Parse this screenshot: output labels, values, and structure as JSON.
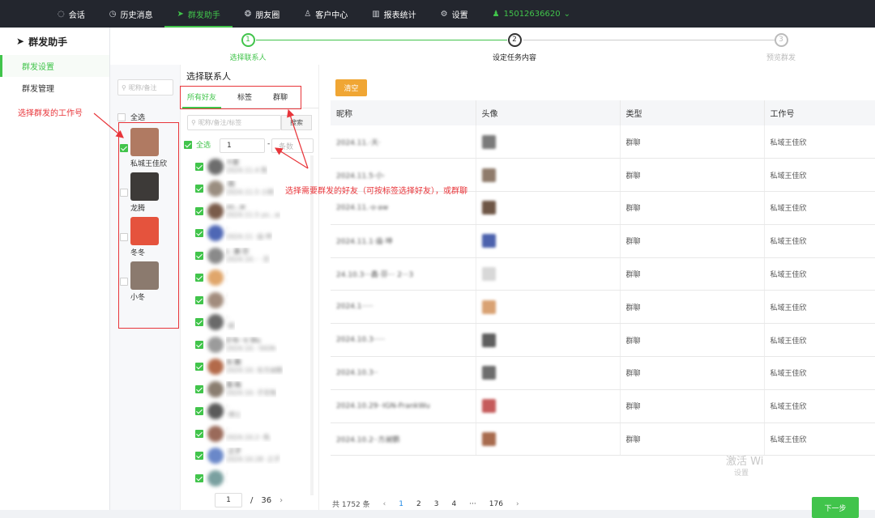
{
  "topnav": {
    "items": [
      {
        "label": "会话",
        "icon": "chat-icon"
      },
      {
        "label": "历史消息",
        "icon": "clock-icon"
      },
      {
        "label": "群发助手",
        "icon": "send-icon",
        "active": true
      },
      {
        "label": "朋友圈",
        "icon": "aperture-icon"
      },
      {
        "label": "客户中心",
        "icon": "user-icon"
      },
      {
        "label": "报表统计",
        "icon": "bar-chart-icon"
      },
      {
        "label": "设置",
        "icon": "gear-icon"
      }
    ],
    "user_phone": "15012636620",
    "accent_color": "#41c44b"
  },
  "sidebar": {
    "title": "群发助手",
    "items": [
      {
        "label": "群发设置",
        "active": true
      },
      {
        "label": "群发管理"
      }
    ]
  },
  "steps": [
    {
      "num": "1",
      "label": "选择联系人",
      "state": "done"
    },
    {
      "num": "2",
      "label": "设定任务内容",
      "state": "current"
    },
    {
      "num": "3",
      "label": "预览群发",
      "state": "todo"
    }
  ],
  "accounts_panel": {
    "search_placeholder": "昵称/备注",
    "select_all": "全选",
    "accounts": [
      {
        "name": "私城王佳欣",
        "checked": true,
        "avatar_color": "#b07a62"
      },
      {
        "name": "龙腾",
        "checked": false,
        "avatar_color": "#3d3a38"
      },
      {
        "name": "冬冬",
        "checked": false,
        "avatar_color": "#e5533d"
      },
      {
        "name": "小冬",
        "checked": false,
        "avatar_color": "#8b7a6e"
      }
    ]
  },
  "contacts_panel": {
    "title": "选择联系人",
    "tabs": [
      "所有好友",
      "标签",
      "群聊"
    ],
    "search_placeholder": "昵称/备注/标签",
    "search_button": "搜索",
    "select_all": "全选",
    "range_from": "1",
    "range_to_placeholder": "条数",
    "range_sep": "-",
    "rows": [
      {
        "line1": "十度",
        "line2": "2024.11.4 数",
        "color": "#6d6d6d"
      },
      {
        "line1": "·刚",
        "line2": "2024.11.5 小刚",
        "color": "#9a8d80"
      },
      {
        "line1": "vo...w",
        "line2": "2024.11.5 yo...w",
        "color": "#7a5b4a"
      },
      {
        "line1": "·",
        "line2": "2024.11 ·庙·坤",
        "color": "#4e67b5"
      },
      {
        "line1": "L· 鑫·芬",
        "line2": "2024.10.·· ·芬",
        "color": "#8a8a8a"
      },
      {
        "line1": "·",
        "line2": "·",
        "color": "#e0a66b"
      },
      {
        "line1": "·",
        "line2": "·",
        "color": "#a28c7d"
      },
      {
        "line1": "·",
        "line2": "·越",
        "color": "#6a6a6a"
      },
      {
        "line1": "D·N-··k Wu",
        "line2": "2024.10.··SIGN-",
        "color": "#9b9b9b"
      },
      {
        "line1": "东·鹏",
        "line2": "2024.10.·东方昶鹏",
        "color": "#b36a4a"
      },
      {
        "line1": "落·梅",
        "line2": "2024.10.·子无悔",
        "color": "#8a7d70"
      },
      {
        "line1": "·",
        "line2": "·博士",
        "color": "#5a5a5a"
      },
      {
        "line1": "·",
        "line2": "2024.10.2··角.",
        "color": "#9a6a5a"
      },
      {
        "line1": "·之子",
        "line2": "2024.10.28 ·之子",
        "color": "#6a88c9"
      },
      {
        "line1": "·",
        "line2": "·",
        "color": "#7aa0a0"
      }
    ],
    "pager": {
      "current": "1",
      "sep": "/",
      "total": "36"
    }
  },
  "right_panel": {
    "clear_button": "清空",
    "columns": [
      "昵称",
      "头像",
      "类型",
      "工作号"
    ],
    "rows": [
      {
        "nick": "2024.11.·天·",
        "type": "群聊",
        "account": "私域王佳欣",
        "color": "#7b7b7b"
      },
      {
        "nick": "2024.11.5·小·",
        "type": "群聊",
        "account": "私域王佳欣",
        "color": "#8f7b6b"
      },
      {
        "nick": "2024.11.·o·aw",
        "type": "群聊",
        "account": "私域王佳欣",
        "color": "#6e5646"
      },
      {
        "nick": "2024.11.1·庙·坤",
        "type": "群聊",
        "account": "私域王佳欣",
        "color": "#4c62ad"
      },
      {
        "nick": "24.10.3···鑫·芬··· 2···3",
        "type": "群聊",
        "account": "私域王佳欣",
        "color": "#d8d8d8"
      },
      {
        "nick": "2024.1·····",
        "type": "群聊",
        "account": "私域王佳欣",
        "color": "#d9a273"
      },
      {
        "nick": "2024.10.3·····",
        "type": "群聊",
        "account": "私域王佳欣",
        "color": "#5f5f5f"
      },
      {
        "nick": "2024.10.3··",
        "type": "群聊",
        "account": "私域王佳欣",
        "color": "#6d6d6d"
      },
      {
        "nick": "2024.10.29··IGN-FrankWu",
        "type": "群聊",
        "account": "私域王佳欣",
        "color": "#c55b5b"
      },
      {
        "nick": "2024.10.2··方昶鹏",
        "type": "群聊",
        "account": "私域王佳欣",
        "color": "#a86b4e"
      }
    ],
    "pager": {
      "total_text": "共 1752 条",
      "pages": [
        "1",
        "2",
        "3",
        "4",
        "···",
        "176"
      ],
      "active_page": "1"
    },
    "next_button": "下一步"
  },
  "annotations": {
    "select_account": "选择群发的工作号",
    "select_friends": "选择需要群发的好友（可按标签选择好友），或群聊",
    "color": "#e8353a"
  },
  "watermark": {
    "line1": "激活 Wi",
    "line2": "设置"
  }
}
